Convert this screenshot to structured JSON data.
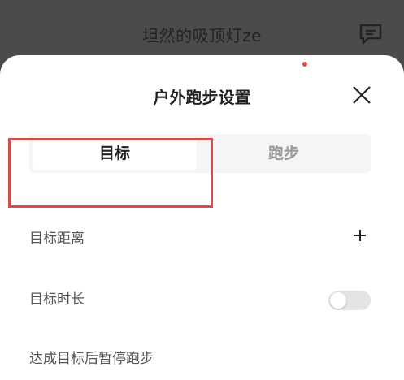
{
  "header": {
    "username": "坦然的吸顶灯ze",
    "chat_icon": "chat-bubble-icon"
  },
  "sheet": {
    "title": "户外跑步设置",
    "tabs": [
      {
        "label": "目标",
        "active": true
      },
      {
        "label": "跑步",
        "active": false,
        "has_dot": true
      }
    ],
    "settings": [
      {
        "label": "目标距离",
        "control": "plus"
      },
      {
        "label": "目标时长",
        "control": "plus"
      },
      {
        "label": "达成目标后暂停跑步",
        "control": "toggle",
        "value": false
      }
    ]
  },
  "colors": {
    "highlight": "#d94a4a",
    "dot": "#e64545"
  }
}
